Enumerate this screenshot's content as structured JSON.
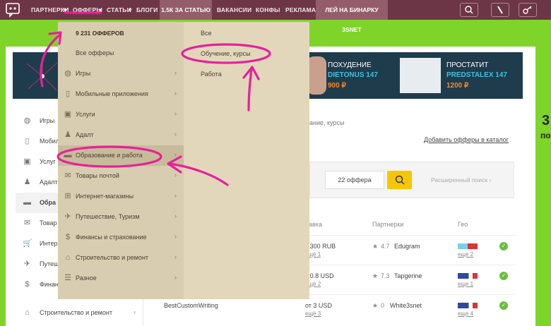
{
  "nav": {
    "items": [
      "ПАРТНЕРКИ",
      "ОФФЕРЫ",
      "СТАТЬИ",
      "БЛОГИ",
      "1.5К ЗА СТАТЬЮ",
      "ВАКАНСИИ",
      "КОНФЫ",
      "РЕКЛАМА",
      "ЛЕЙ НА БИНАРКУ 3SNET"
    ],
    "icons": [
      "search-icon",
      "pen-icon",
      "key-icon"
    ]
  },
  "dropdown": {
    "header": "9 231 ОФФЕРОВ",
    "all": "Все офферы",
    "items": [
      {
        "label": "Игры",
        "icon": "gamepad-icon"
      },
      {
        "label": "Мобильные приложения",
        "icon": "phone-icon"
      },
      {
        "label": "Услуги",
        "icon": "services-icon"
      },
      {
        "label": "Адалт",
        "icon": "adult-icon"
      },
      {
        "label": "Образование и работа",
        "icon": "education-icon"
      },
      {
        "label": "Товары почтой",
        "icon": "mail-icon"
      },
      {
        "label": "Интернет-магазины",
        "icon": "cart-icon"
      },
      {
        "label": "Путешествие, Туризм",
        "icon": "plane-icon"
      },
      {
        "label": "Финансы и страхование",
        "icon": "money-icon"
      },
      {
        "label": "Строительство и ремонт",
        "icon": "house-icon"
      },
      {
        "label": "Разное",
        "icon": "list-icon"
      }
    ],
    "sub_items": [
      "Все",
      "Обучение, курсы",
      "Работа"
    ]
  },
  "sidebar": {
    "items": [
      "Игры",
      "Мобил",
      "Услуг",
      "Адалт",
      "Обра",
      "Товар",
      "Интер",
      "Путеш",
      "Финан",
      "Строительство и ремонт"
    ]
  },
  "banner": {
    "left_title": "ПОХУДЕНИЕ",
    "left_name": "DIETONUS 147",
    "left_price": "900 ₽",
    "right_title": "ПРОСТАТИТ",
    "right_name": "PREDSTALEX 147",
    "right_price": "1200 ₽"
  },
  "main": {
    "breadcrumb": "ание, курсы",
    "add_link": "Добавить офферы в каталог",
    "offer_count": "22 оффера",
    "advanced_search": "Расширенный поиск",
    "columns": [
      "тавка",
      "Партнерки",
      "Гео"
    ],
    "rows": [
      {
        "name": "",
        "rate": "т 300 RUB",
        "rate_more": "ещё 1",
        "rating": "4.7",
        "partner": "Edugram",
        "geo_more": "еще 2"
      },
      {
        "name": "",
        "rate": "т 0.8 USD",
        "rate_more": "ещё 2",
        "rating": "7.3",
        "partner": "Tapgerine",
        "geo_more": "еще 1"
      },
      {
        "name": "BestCustomWriting",
        "rate": "от 3 USD",
        "rate_more": "ещё 3",
        "rating": "0",
        "partner": "White3snet",
        "geo_more": "еще 4"
      }
    ]
  },
  "right_edge": {
    "big": "3",
    "small": "по"
  },
  "colors": {
    "nav_bg": "#6d3646",
    "dropdown_bg": "#d8cdb1",
    "page_bg": "#7fd42a",
    "accent_pink": "#e8209a",
    "search_yellow": "#f6c700"
  }
}
